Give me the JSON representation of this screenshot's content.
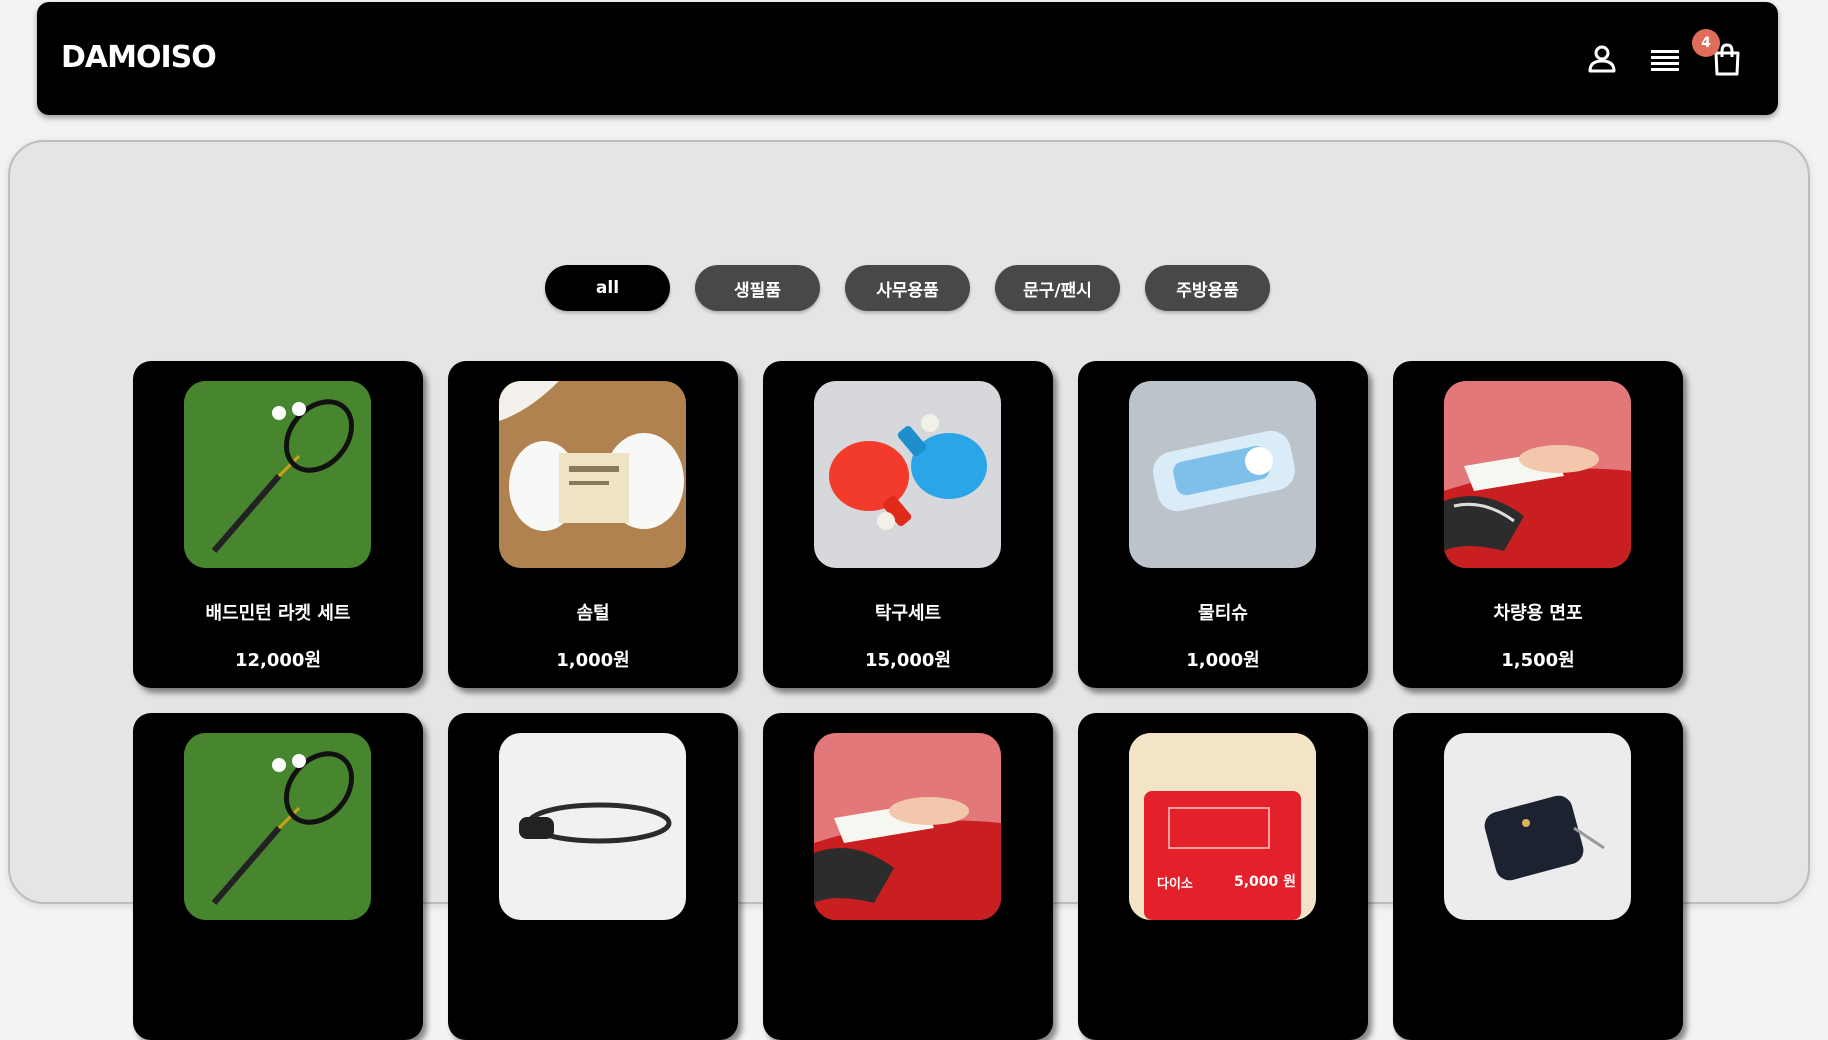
{
  "header": {
    "logo": "DAMOISO",
    "cart_count": "4",
    "icons": [
      "user-icon",
      "menu-icon",
      "shopping-bag-icon"
    ]
  },
  "filters": [
    {
      "label": "all",
      "active": true
    },
    {
      "label": "생필품",
      "active": false
    },
    {
      "label": "사무용품",
      "active": false
    },
    {
      "label": "문구/팬시",
      "active": false
    },
    {
      "label": "주방용품",
      "active": false
    }
  ],
  "products": [
    {
      "name": "배드민턴 라켓 세트",
      "price": "12,000원",
      "image": "badminton-racket-image"
    },
    {
      "name": "솜털",
      "price": "1,000원",
      "image": "cotton-fluff-image"
    },
    {
      "name": "탁구세트",
      "price": "15,000원",
      "image": "ping-pong-set-image"
    },
    {
      "name": "물티슈",
      "price": "1,000원",
      "image": "wet-wipes-image"
    },
    {
      "name": "차량용 면포",
      "price": "1,500원",
      "image": "car-cloth-image"
    },
    {
      "name": "",
      "price": "",
      "image": "badminton-racket-image"
    },
    {
      "name": "",
      "price": "",
      "image": "black-cable-image"
    },
    {
      "name": "",
      "price": "",
      "image": "car-cloth-image"
    },
    {
      "name": "",
      "price": "",
      "image": "gift-card-image"
    },
    {
      "name": "",
      "price": "",
      "image": "zip-wallet-image"
    }
  ],
  "gift_card": {
    "brand": "다이소",
    "amount": "5,000 원"
  },
  "colors": {
    "header_bg": "#000000",
    "chip_bg": "#4a4749",
    "badge": "#e06d59",
    "panel_bg": "#e5e5e5"
  }
}
